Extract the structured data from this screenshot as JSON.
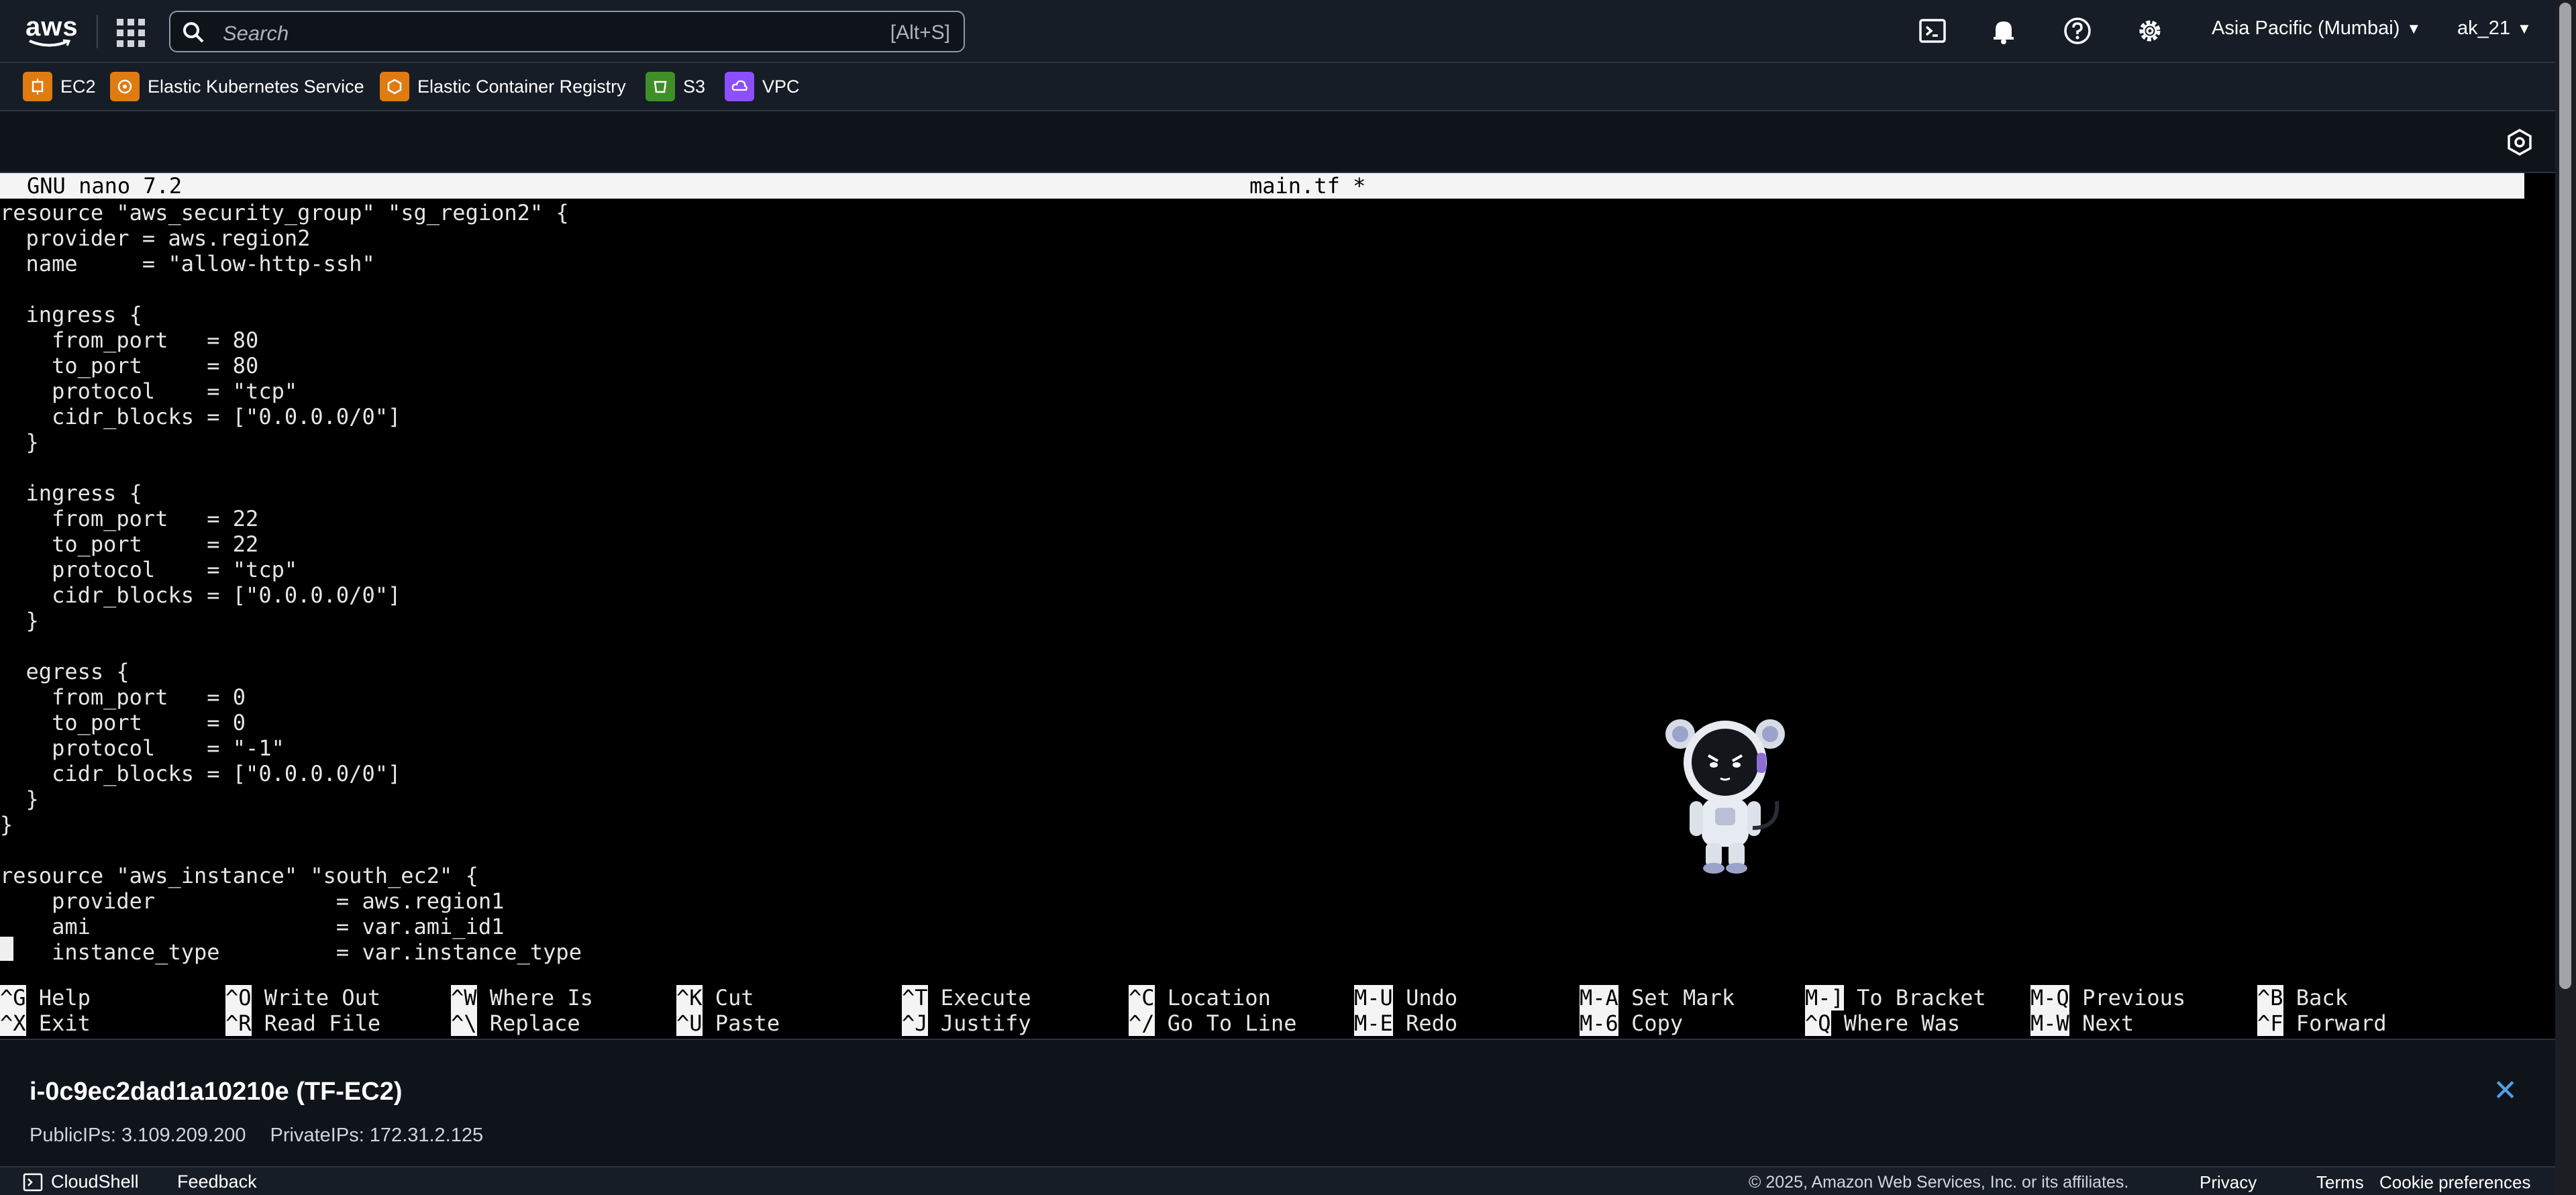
{
  "topnav": {
    "logo_text": "aws",
    "search_placeholder": "Search",
    "search_shortcut": "[Alt+S]",
    "icons": [
      "cloudshell-icon",
      "bell-icon",
      "help-icon",
      "gear-icon"
    ],
    "region": "Asia Pacific (Mumbai)",
    "user": "ak_21"
  },
  "favorites": [
    {
      "label": "EC2",
      "color": "#e07b12"
    },
    {
      "label": "Elastic Kubernetes Service",
      "color": "#e07b12"
    },
    {
      "label": "Elastic Container Registry",
      "color": "#e07b12"
    },
    {
      "label": "S3",
      "color": "#3f8f29"
    },
    {
      "label": "VPC",
      "color": "#8c4fff"
    }
  ],
  "terminal": {
    "nano_version": "GNU nano 7.2",
    "file_title": "main.tf *",
    "code_lines": [
      "resource \"aws_security_group\" \"sg_region2\" {",
      "  provider = aws.region2",
      "  name     = \"allow-http-ssh\"",
      "",
      "  ingress {",
      "    from_port   = 80",
      "    to_port     = 80",
      "    protocol    = \"tcp\"",
      "    cidr_blocks = [\"0.0.0.0/0\"]",
      "  }",
      "",
      "  ingress {",
      "    from_port   = 22",
      "    to_port     = 22",
      "    protocol    = \"tcp\"",
      "    cidr_blocks = [\"0.0.0.0/0\"]",
      "  }",
      "",
      "  egress {",
      "    from_port   = 0",
      "    to_port     = 0",
      "    protocol    = \"-1\"",
      "    cidr_blocks = [\"0.0.0.0/0\"]",
      "  }",
      "}",
      "",
      "resource \"aws_instance\" \"south_ec2\" {",
      "    provider              = aws.region1",
      "    ami                   = var.ami_id1",
      "    instance_type         = var.instance_type"
    ],
    "shortcuts_row1": [
      {
        "key": "^G",
        "label": "Help"
      },
      {
        "key": "^O",
        "label": "Write Out"
      },
      {
        "key": "^W",
        "label": "Where Is"
      },
      {
        "key": "^K",
        "label": "Cut"
      },
      {
        "key": "^T",
        "label": "Execute"
      },
      {
        "key": "^C",
        "label": "Location"
      },
      {
        "key": "M-U",
        "label": "Undo"
      },
      {
        "key": "M-A",
        "label": "Set Mark"
      },
      {
        "key": "M-]",
        "label": "To Bracket"
      },
      {
        "key": "M-Q",
        "label": "Previous"
      },
      {
        "key": "^B",
        "label": "Back"
      }
    ],
    "shortcuts_row2": [
      {
        "key": "^X",
        "label": "Exit"
      },
      {
        "key": "^R",
        "label": "Read File"
      },
      {
        "key": "^\\",
        "label": "Replace"
      },
      {
        "key": "^U",
        "label": "Paste"
      },
      {
        "key": "^J",
        "label": "Justify"
      },
      {
        "key": "^/",
        "label": "Go To Line"
      },
      {
        "key": "M-E",
        "label": "Redo"
      },
      {
        "key": "M-6",
        "label": "Copy"
      },
      {
        "key": "^Q",
        "label": "Where Was"
      },
      {
        "key": "M-W",
        "label": "Next"
      },
      {
        "key": "^F",
        "label": "Forward"
      }
    ]
  },
  "instance_panel": {
    "title": "i-0c9ec2dad1a10210e (TF-EC2)",
    "public_ips": "PublicIPs: 3.109.209.200",
    "private_ips": "PrivateIPs: 172.31.2.125"
  },
  "footer": {
    "cloudshell": "CloudShell",
    "feedback": "Feedback",
    "copyright": "© 2025, Amazon Web Services, Inc. or its affiliates.",
    "privacy": "Privacy",
    "terms": "Terms",
    "cookie": "Cookie preferences"
  }
}
